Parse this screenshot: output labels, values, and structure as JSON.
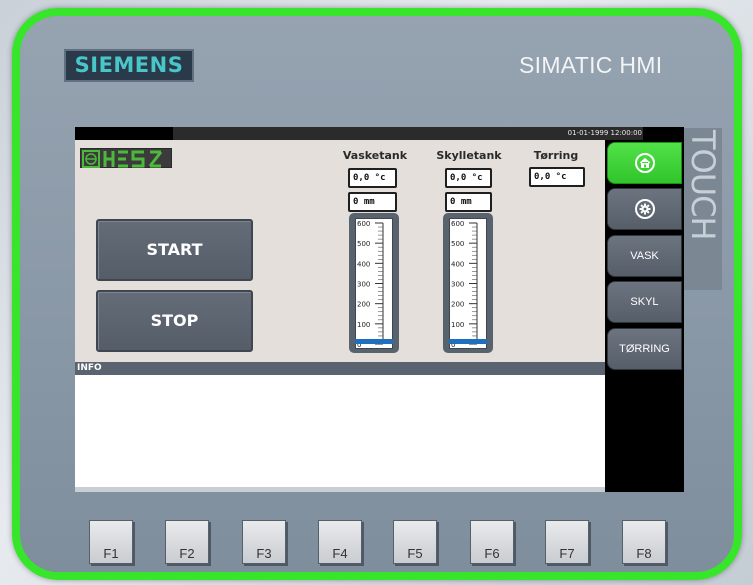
{
  "device": {
    "brand": "SIEMENS",
    "model": "SIMATIC HMI",
    "touch_label": "TOUCH",
    "bezel_color": "#37e52b"
  },
  "status_bar": {
    "datetime": "01-01-1999 12:00:00"
  },
  "logo": {
    "text": "HESO",
    "icon": "heso-logo"
  },
  "columns": [
    {
      "title": "Vasketank",
      "temperature": "0,0 °c",
      "level": "0 mm",
      "gauge": {
        "max": 600,
        "value": 0,
        "ticks": [
          "600",
          "500",
          "400",
          "300",
          "200",
          "100",
          "0"
        ]
      }
    },
    {
      "title": "Skylletank",
      "temperature": "0,0 °c",
      "level": "0 mm",
      "gauge": {
        "max": 600,
        "value": 0,
        "ticks": [
          "600",
          "500",
          "400",
          "300",
          "200",
          "100",
          "0"
        ]
      }
    },
    {
      "title": "Tørring",
      "temperature": "0,0 °c"
    }
  ],
  "controls": {
    "start_label": "START",
    "stop_label": "STOP"
  },
  "info": {
    "label": "INFO"
  },
  "nav": {
    "items": [
      {
        "label": "",
        "icon": "home-icon",
        "active": true
      },
      {
        "label": "",
        "icon": "settings-icon",
        "active": false
      },
      {
        "label": "VASK",
        "icon": "",
        "active": false
      },
      {
        "label": "SKYL",
        "icon": "",
        "active": false
      },
      {
        "label": "TØRRING",
        "icon": "",
        "active": false
      }
    ]
  },
  "function_keys": [
    "F1",
    "F2",
    "F3",
    "F4",
    "F5",
    "F6",
    "F7",
    "F8"
  ],
  "colors": {
    "active_nav": "#3fd236",
    "gauge_fill": "#1e6fbd",
    "panel_bg": "#e4dfdb",
    "brand_text": "#49c6c8"
  }
}
